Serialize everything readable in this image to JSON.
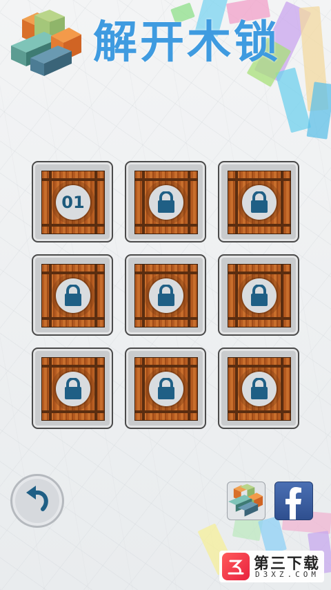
{
  "header": {
    "title": "解开木锁",
    "logo_icon": "wooden-burr-puzzle-icon"
  },
  "levels": [
    {
      "label": "01",
      "locked": false
    },
    {
      "label": "",
      "locked": true
    },
    {
      "label": "",
      "locked": true
    },
    {
      "label": "",
      "locked": true
    },
    {
      "label": "",
      "locked": true
    },
    {
      "label": "",
      "locked": true
    },
    {
      "label": "",
      "locked": true
    },
    {
      "label": "",
      "locked": true
    },
    {
      "label": "",
      "locked": true
    }
  ],
  "footer": {
    "back_icon": "undo-arrow-icon",
    "more_games_icon": "wooden-burr-puzzle-icon",
    "share_icon": "facebook-icon"
  },
  "watermark": {
    "name": "第三下载",
    "domain": "D3XZ.COM"
  },
  "colors": {
    "title": "#3f9be0",
    "lock": "#1f5f85",
    "wood": "#b45a20",
    "facebook": "#3b5998"
  }
}
